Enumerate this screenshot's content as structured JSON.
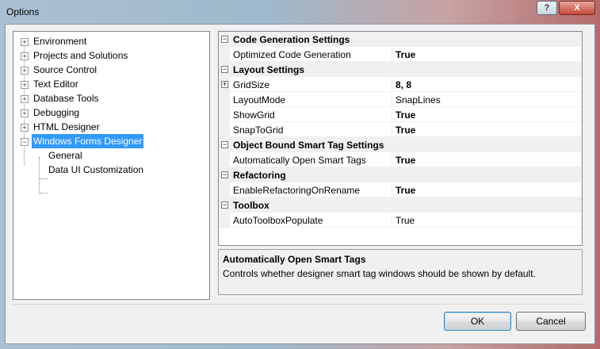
{
  "window": {
    "title": "Options",
    "help_label": "?",
    "minimize_label": "",
    "close_label": "X"
  },
  "tree": {
    "items": [
      {
        "label": "Environment",
        "expander": "+"
      },
      {
        "label": "Projects and Solutions",
        "expander": "+"
      },
      {
        "label": "Source Control",
        "expander": "+"
      },
      {
        "label": "Text Editor",
        "expander": "+"
      },
      {
        "label": "Database Tools",
        "expander": "+"
      },
      {
        "label": "Debugging",
        "expander": "+"
      },
      {
        "label": "HTML Designer",
        "expander": "+"
      },
      {
        "label": "Windows Forms Designer",
        "expander": "−",
        "selected": true
      },
      {
        "label": "General"
      },
      {
        "label": "Data UI Customization"
      }
    ]
  },
  "property_grid": {
    "categories": [
      {
        "name": "Code Generation Settings",
        "toggle": "−",
        "props": [
          {
            "name": "Optimized Code Generation",
            "value": "True",
            "bold": true
          }
        ]
      },
      {
        "name": "Layout Settings",
        "toggle": "−",
        "props": [
          {
            "name": "GridSize",
            "value": "8, 8",
            "bold": true,
            "toggle": "+"
          },
          {
            "name": "LayoutMode",
            "value": "SnapLines",
            "bold": false
          },
          {
            "name": "ShowGrid",
            "value": "True",
            "bold": true
          },
          {
            "name": "SnapToGrid",
            "value": "True",
            "bold": true
          }
        ]
      },
      {
        "name": "Object Bound Smart Tag Settings",
        "toggle": "−",
        "props": [
          {
            "name": "Automatically Open Smart Tags",
            "value": "True",
            "bold": true
          }
        ]
      },
      {
        "name": "Refactoring",
        "toggle": "−",
        "props": [
          {
            "name": "EnableRefactoringOnRename",
            "value": "True",
            "bold": true
          }
        ]
      },
      {
        "name": "Toolbox",
        "toggle": "−",
        "props": [
          {
            "name": "AutoToolboxPopulate",
            "value": "True",
            "bold": false
          }
        ]
      }
    ]
  },
  "description": {
    "title": "Automatically Open Smart Tags",
    "text": "Controls whether designer smart tag windows should be shown by default."
  },
  "buttons": {
    "ok": "OK",
    "cancel": "Cancel"
  }
}
